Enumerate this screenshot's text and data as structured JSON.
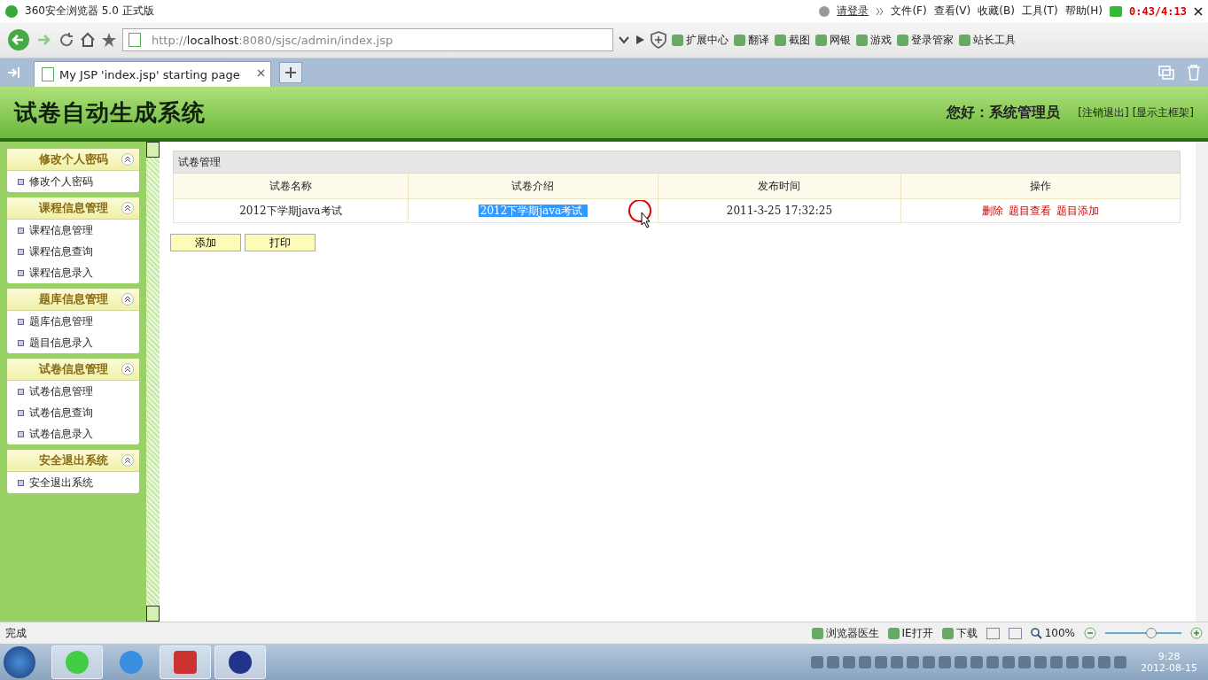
{
  "browser": {
    "title": "360安全浏览器 5.0 正式版",
    "login": "请登录",
    "menus": [
      "文件(F)",
      "查看(V)",
      "收藏(B)",
      "工具(T)",
      "帮助(H)"
    ],
    "timer": "0:43/4:13",
    "url_prefix": "http://",
    "url_host": "localhost",
    "url_rest": ":8080/sjsc/admin/index.jsp",
    "toolbar": [
      "扩展中心",
      "翻译",
      "截图",
      "网银",
      "游戏",
      "登录管家",
      "站长工具"
    ],
    "tabs": [
      {
        "label": "My JSP 'index.jsp' starting page",
        "selected": true
      }
    ]
  },
  "header": {
    "title": "试卷自动生成系统",
    "greeting": "您好：系统管理员",
    "links": [
      "[注销退出]",
      "[显示主框架]"
    ]
  },
  "sidebar": [
    {
      "title": "修改个人密码",
      "expanded": true,
      "items": [
        "修改个人密码"
      ]
    },
    {
      "title": "课程信息管理",
      "expanded": true,
      "items": [
        "课程信息管理",
        "课程信息查询",
        "课程信息录入"
      ]
    },
    {
      "title": "题库信息管理",
      "expanded": true,
      "items": [
        "题库信息管理",
        "题目信息录入"
      ]
    },
    {
      "title": "试卷信息管理",
      "expanded": true,
      "items": [
        "试卷信息管理",
        "试卷信息查询",
        "试卷信息录入"
      ]
    },
    {
      "title": "安全退出系统",
      "expanded": true,
      "items": [
        "安全退出系统"
      ]
    }
  ],
  "table": {
    "caption": "试卷管理",
    "columns": [
      "试卷名称",
      "试卷介绍",
      "发布时间",
      "操作"
    ],
    "rows": [
      {
        "name": "2012下学期java考试",
        "intro": "2012下学期java考试",
        "intro_highlighted": true,
        "time": "2011-3-25 17:32:25",
        "actions": [
          "删除",
          "题目查看",
          "题目添加"
        ]
      }
    ]
  },
  "buttons": [
    "添加",
    "打印"
  ],
  "status_bar": {
    "text": "完成",
    "items": [
      "浏览器医生",
      "IE打开",
      "下载"
    ],
    "zoom": "100%",
    "level": 0.6
  },
  "taskbar": {
    "time": "9:28",
    "date": "2012-08-15"
  }
}
